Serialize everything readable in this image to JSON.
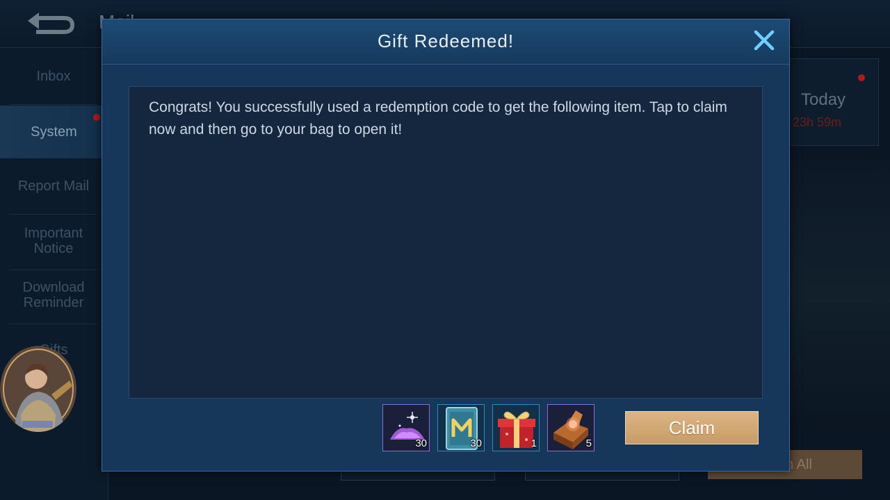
{
  "background": {
    "title": "Mail",
    "sidebar": {
      "items": [
        {
          "label": "Inbox"
        },
        {
          "label": "System"
        },
        {
          "label": "Report Mail"
        },
        {
          "label": "Important Notice"
        },
        {
          "label": "Download Reminder"
        },
        {
          "label": "Gifts"
        }
      ]
    },
    "mail": {
      "date": "Today",
      "expiry": "23h 59m"
    },
    "claim_all_label": "Claim All"
  },
  "modal": {
    "title": "Gift Redeemed!",
    "message": "Congrats! You successfully used a redemption code to get the following item. Tap to claim now and then go to your bag to open it!",
    "items": [
      {
        "icon": "magic-dust-icon",
        "count": "30"
      },
      {
        "icon": "magic-card-icon",
        "count": "30"
      },
      {
        "icon": "gift-box-icon",
        "count": "1"
      },
      {
        "icon": "crate-icon",
        "count": "5"
      }
    ],
    "claim_label": "Claim"
  }
}
